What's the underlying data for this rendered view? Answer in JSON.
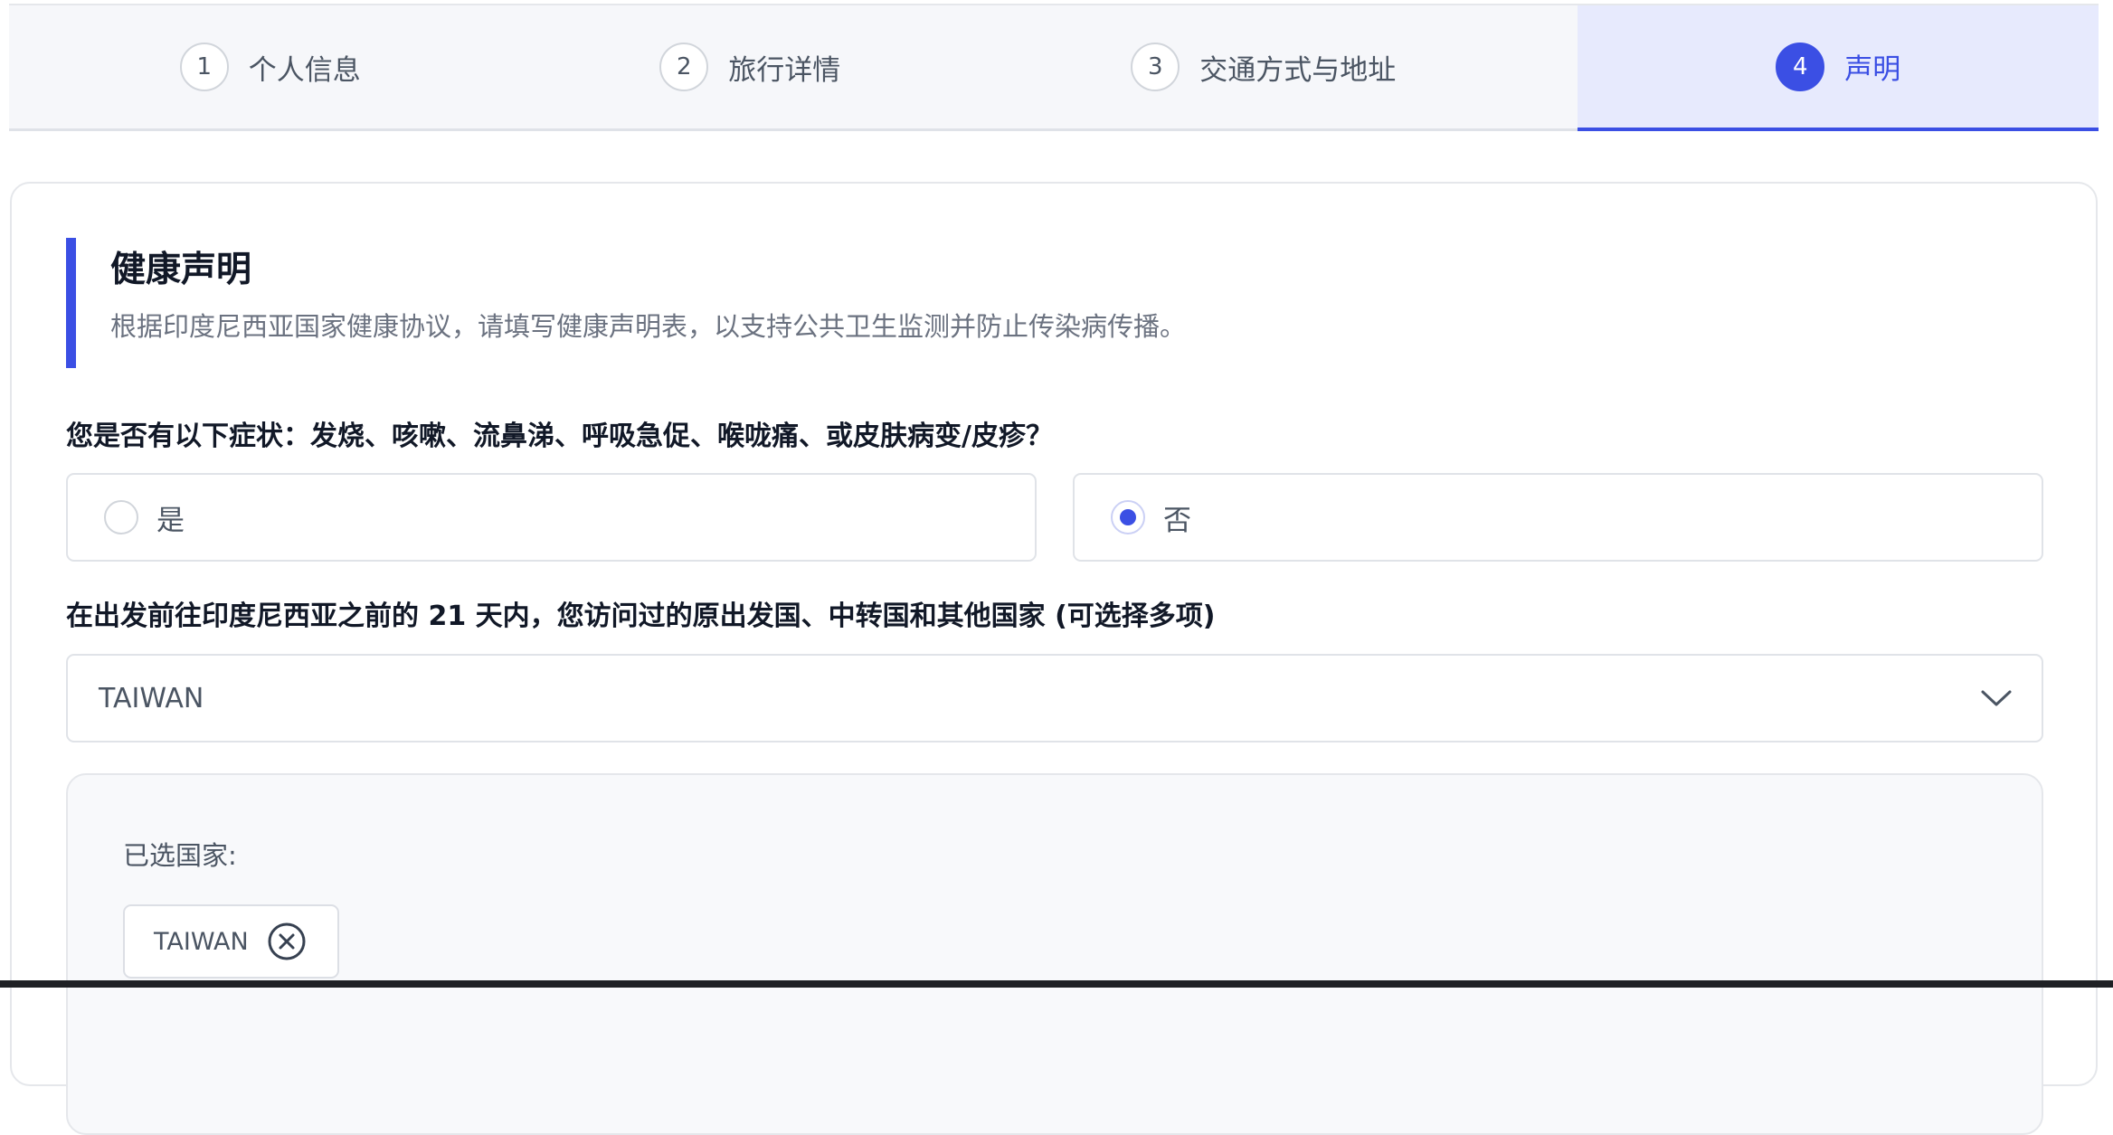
{
  "stepper": {
    "steps": [
      {
        "number": "1",
        "label": "个人信息"
      },
      {
        "number": "2",
        "label": "旅行详情"
      },
      {
        "number": "3",
        "label": "交通方式与地址"
      },
      {
        "number": "4",
        "label": "声明"
      }
    ],
    "active_step": 4
  },
  "section": {
    "title": "健康声明",
    "description": "根据印度尼西亚国家健康协议，请填写健康声明表，以支持公共卫生监测并防止传染病传播。"
  },
  "symptoms_question": {
    "label": "您是否有以下症状：发烧、咳嗽、流鼻涕、呼吸急促、喉咙痛、或皮肤病变/皮疹？",
    "options": [
      {
        "label": "是",
        "selected": false
      },
      {
        "label": "否",
        "selected": true
      }
    ]
  },
  "countries_question": {
    "label": "在出发前往印度尼西亚之前的 21 天内，您访问过的原出发国、中转国和其他国家 (可选择多项)",
    "select_value": "TAIWAN"
  },
  "selected_countries": {
    "title": "已选国家:",
    "chips": [
      "TAIWAN"
    ]
  },
  "icons": {
    "dropdown": "chevron-down-icon",
    "chip_remove": "close-circle-icon"
  },
  "colors": {
    "accent": "#3b4fe4",
    "active_step_bg": "#e7eafd"
  }
}
